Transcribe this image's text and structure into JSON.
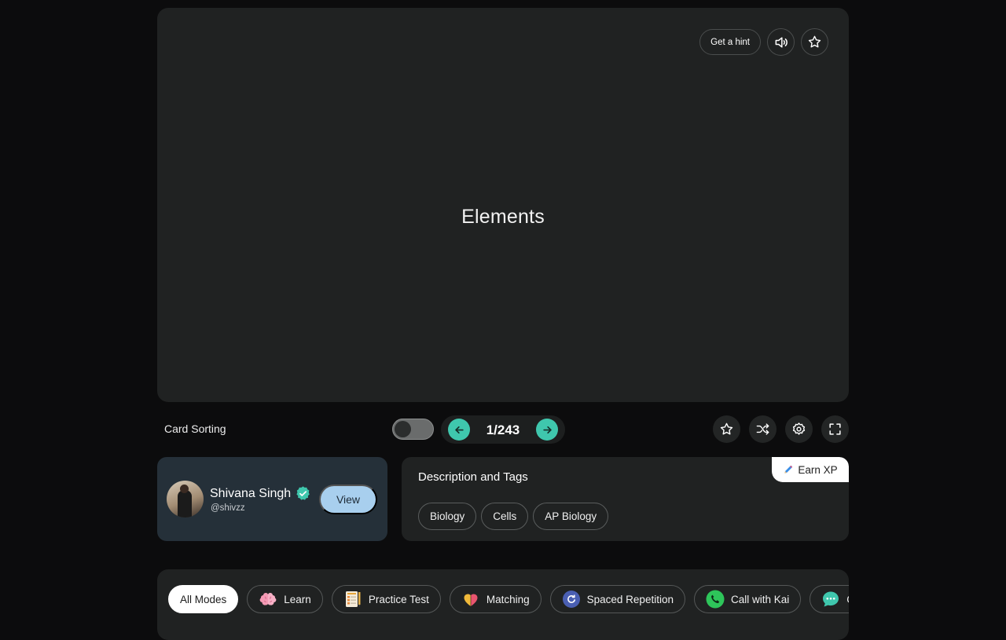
{
  "card": {
    "term": "Elements",
    "hint_label": "Get a hint",
    "audio_icon": "speaker-icon",
    "star_icon": "star-icon"
  },
  "controls": {
    "sorting_label": "Card Sorting",
    "sorting_enabled": false,
    "position": "1/243",
    "tools": [
      "star-icon",
      "shuffle-icon",
      "gear-icon",
      "fullscreen-icon"
    ]
  },
  "author": {
    "name": "Shivana Singh",
    "handle": "@shivzz",
    "view_label": "View",
    "verified": true
  },
  "description": {
    "title": "Description and Tags",
    "earn_label": "Earn XP",
    "tags": [
      "Biology",
      "Cells",
      "AP Biology"
    ]
  },
  "modes": {
    "items": [
      {
        "label": "All Modes",
        "icon": "",
        "active": true
      },
      {
        "label": "Learn",
        "icon": "brain-icon",
        "active": false
      },
      {
        "label": "Practice Test",
        "icon": "test-sheet-icon",
        "active": false
      },
      {
        "label": "Matching",
        "icon": "heart-puzzle-icon",
        "active": false
      },
      {
        "label": "Spaced Repetition",
        "icon": "cycle-icon",
        "active": false
      },
      {
        "label": "Call with Kai",
        "icon": "phone-icon",
        "active": false
      },
      {
        "label": "C",
        "icon": "chat-icon",
        "active": false
      }
    ]
  },
  "colors": {
    "accent": "#3fc7ad",
    "card_bg": "#202222",
    "author_bg": "#253039",
    "view_button": "#a8cfee"
  }
}
